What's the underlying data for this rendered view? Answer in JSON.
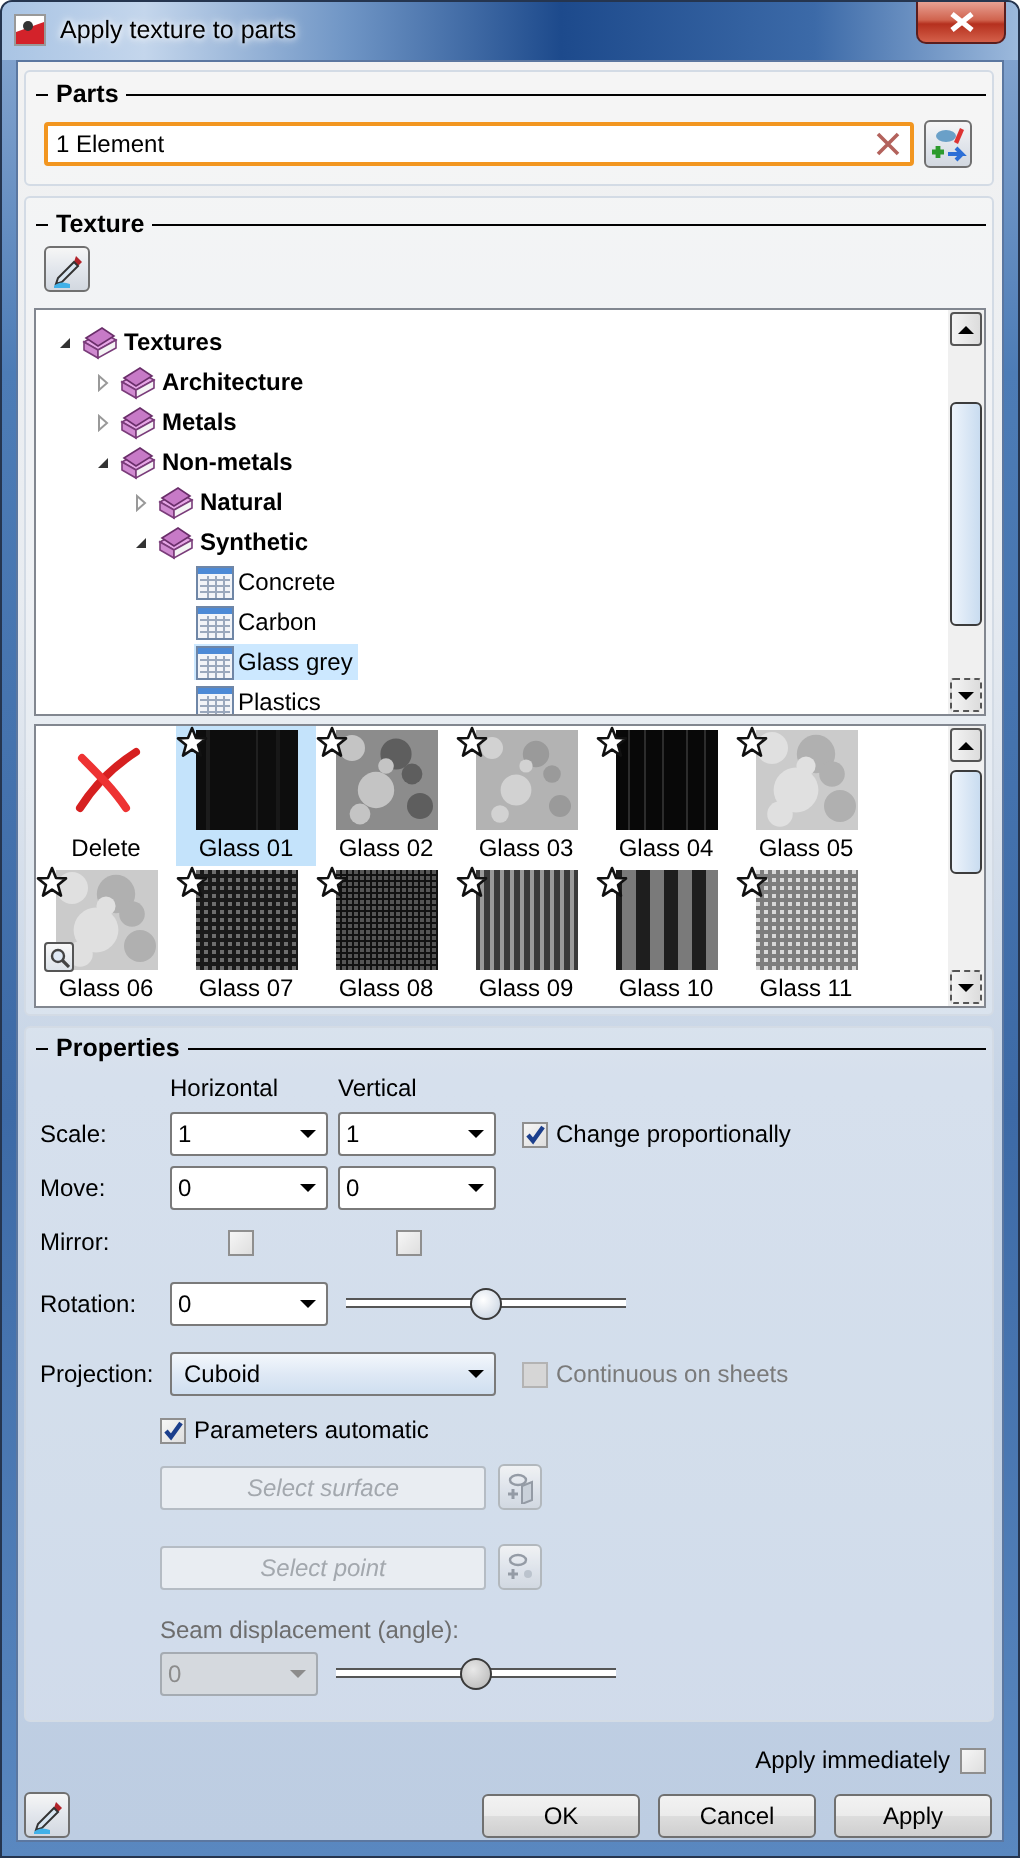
{
  "window": {
    "title": "Apply texture to parts"
  },
  "parts": {
    "heading": "Parts",
    "value": "1 Element"
  },
  "texture": {
    "heading": "Texture",
    "tree": [
      {
        "kind": "folder",
        "label": "Textures",
        "expanded": true,
        "children": [
          {
            "kind": "folder",
            "label": "Architecture",
            "expanded": false
          },
          {
            "kind": "folder",
            "label": "Metals",
            "expanded": false
          },
          {
            "kind": "folder",
            "label": "Non-metals",
            "expanded": true,
            "children": [
              {
                "kind": "folder",
                "label": "Natural",
                "expanded": false
              },
              {
                "kind": "folder",
                "label": "Synthetic",
                "expanded": true,
                "children": [
                  {
                    "kind": "item",
                    "label": "Concrete",
                    "selected": false
                  },
                  {
                    "kind": "item",
                    "label": "Carbon",
                    "selected": false
                  },
                  {
                    "kind": "item",
                    "label": "Glass grey",
                    "selected": true
                  },
                  {
                    "kind": "item",
                    "label": "Plastics",
                    "selected": false
                  }
                ]
              }
            ]
          }
        ]
      }
    ],
    "gallery": [
      {
        "kind": "delete",
        "label": "Delete",
        "selected": false
      },
      {
        "kind": "texture",
        "label": "Glass 01",
        "selected": true,
        "favorite": false
      },
      {
        "kind": "texture",
        "label": "Glass 02",
        "selected": false,
        "favorite": false
      },
      {
        "kind": "texture",
        "label": "Glass 03",
        "selected": false,
        "favorite": false
      },
      {
        "kind": "texture",
        "label": "Glass 04",
        "selected": false,
        "favorite": false
      },
      {
        "kind": "texture",
        "label": "Glass 05",
        "selected": false,
        "favorite": false
      },
      {
        "kind": "texture",
        "label": "Glass 06",
        "selected": false,
        "favorite": false
      },
      {
        "kind": "texture",
        "label": "Glass 07",
        "selected": false,
        "favorite": false
      },
      {
        "kind": "texture",
        "label": "Glass 08",
        "selected": false,
        "favorite": false
      },
      {
        "kind": "texture",
        "label": "Glass 09",
        "selected": false,
        "favorite": false
      },
      {
        "kind": "texture",
        "label": "Glass 10",
        "selected": false,
        "favorite": false
      },
      {
        "kind": "texture",
        "label": "Glass 11",
        "selected": false,
        "favorite": false
      }
    ]
  },
  "properties": {
    "heading": "Properties",
    "columns": [
      "Horizontal",
      "Vertical"
    ],
    "rows": [
      {
        "kind": "combos",
        "label": "Scale:",
        "values": [
          "1",
          "1"
        ],
        "option": {
          "label": "Change proportionally",
          "checked": true,
          "disabled": false
        }
      },
      {
        "kind": "combos",
        "label": "Move:",
        "values": [
          "0",
          "0"
        ]
      },
      {
        "kind": "checks",
        "label": "Mirror:",
        "checks": [
          {
            "checked": false
          },
          {
            "checked": false
          }
        ]
      },
      {
        "kind": "slider",
        "label": "Rotation:",
        "value": "0",
        "level": 0.5
      },
      {
        "kind": "projection",
        "label": "Projection:",
        "value": "Cuboid",
        "option": {
          "label": "Continuous on sheets",
          "checked": false,
          "disabled": true
        }
      }
    ],
    "parameters_automatic": {
      "label": "Parameters automatic",
      "checked": true
    },
    "select_buttons": [
      {
        "label": "Select surface",
        "disabled": true
      },
      {
        "label": "Select point",
        "disabled": true
      }
    ],
    "seam": {
      "label": "Seam displacement (angle):",
      "value": "0",
      "disabled": true,
      "level": 0.5
    }
  },
  "apply_immediately": {
    "label": "Apply immediately",
    "checked": false
  },
  "buttons": [
    "OK",
    "Cancel",
    "Apply"
  ]
}
